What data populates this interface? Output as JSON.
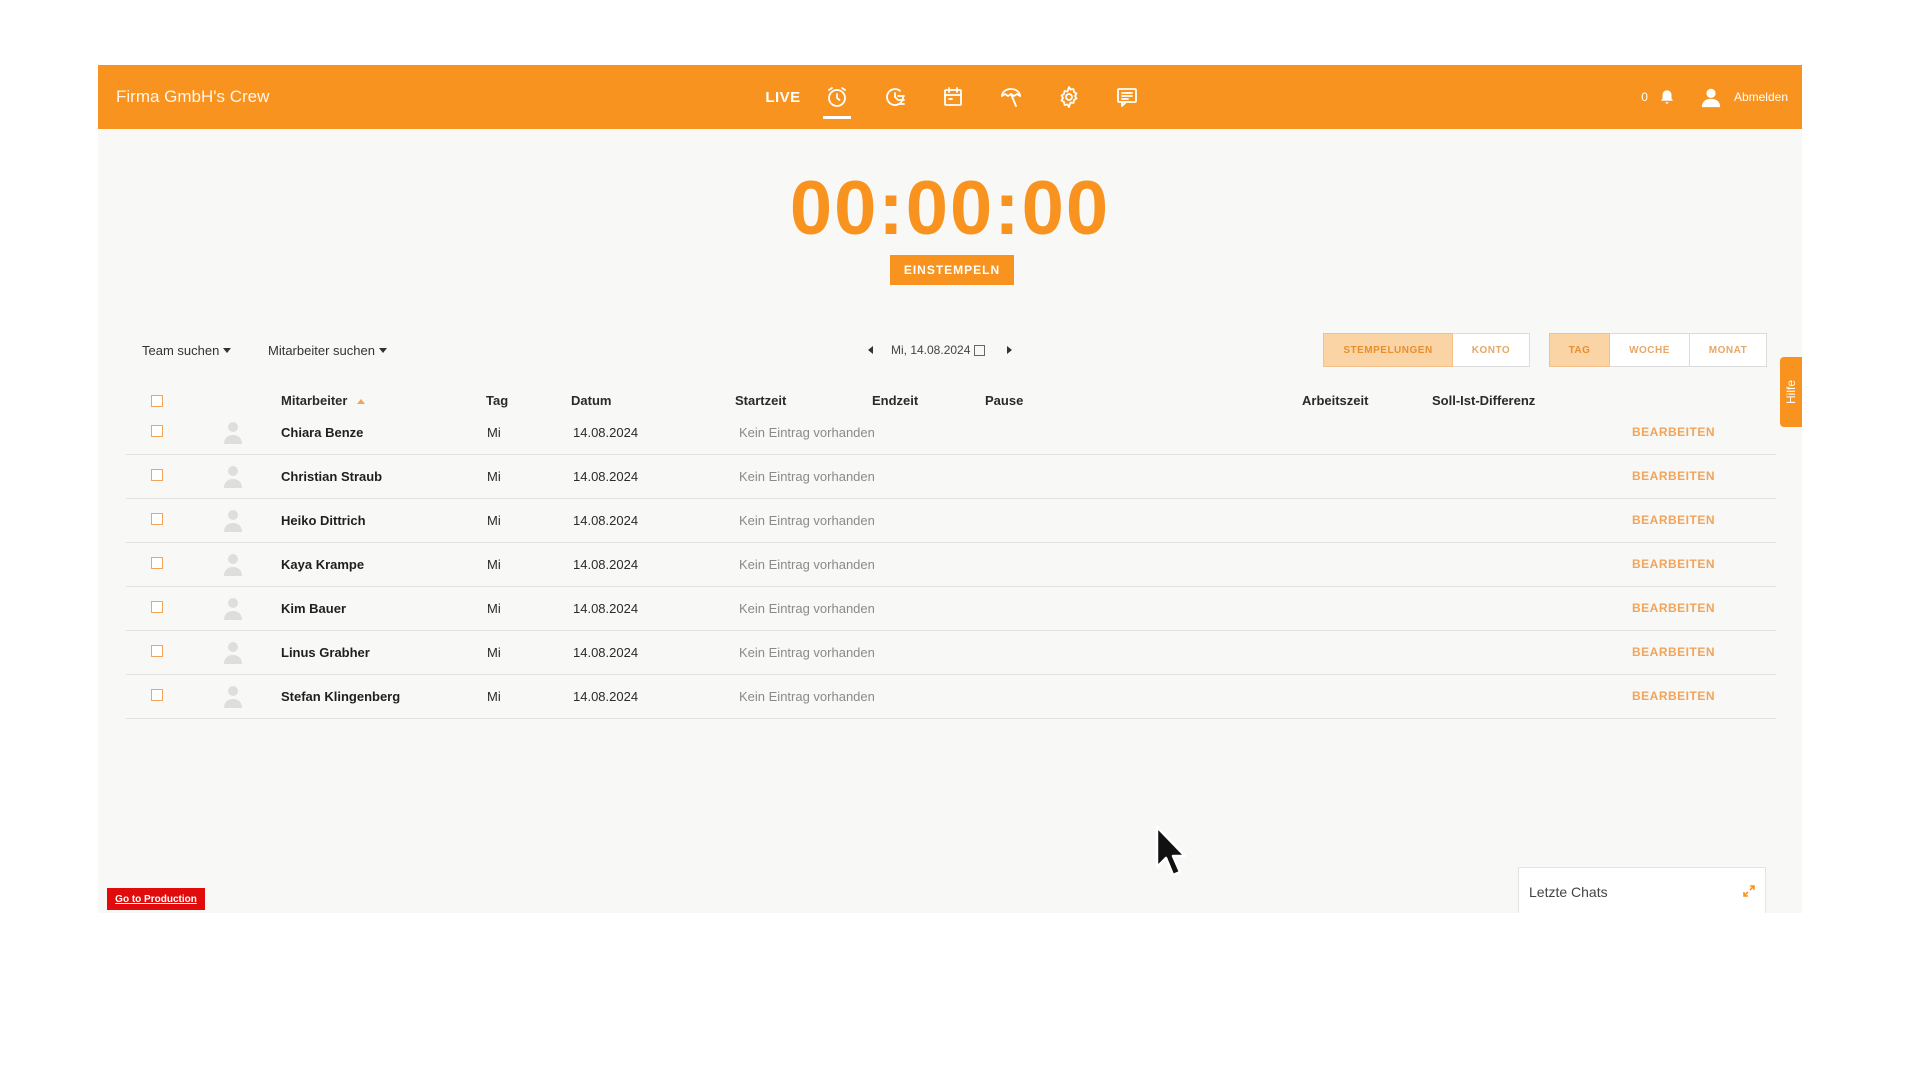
{
  "header": {
    "brand": "Firma GmbH's Crew",
    "live_label": "LIVE",
    "notification_count": "0",
    "logout_label": "Abmelden"
  },
  "timer": {
    "value": "00:00:00",
    "button_label": "EINSTEMPELN"
  },
  "filters": {
    "team_label": "Team suchen",
    "employee_label": "Mitarbeiter suchen",
    "date": "Mi, 14.08.2024"
  },
  "view_toggle": {
    "stamps": "STEMPELUNGEN",
    "account": "KONTO"
  },
  "period_toggle": {
    "day": "TAG",
    "week": "WOCHE",
    "month": "MONAT"
  },
  "help_label": "Hilfe",
  "table": {
    "headers": {
      "employee": "Mitarbeiter",
      "day": "Tag",
      "date": "Datum",
      "start": "Startzeit",
      "end": "Endzeit",
      "pause": "Pause",
      "worktime": "Arbeitszeit",
      "diff": "Soll-Ist-Differenz"
    },
    "rows": [
      {
        "name": "Chiara Benze",
        "day": "Mi",
        "date": "14.08.2024",
        "status": "Kein Eintrag vorhanden",
        "action": "BEARBEITEN"
      },
      {
        "name": "Christian Straub",
        "day": "Mi",
        "date": "14.08.2024",
        "status": "Kein Eintrag vorhanden",
        "action": "BEARBEITEN"
      },
      {
        "name": "Heiko Dittrich",
        "day": "Mi",
        "date": "14.08.2024",
        "status": "Kein Eintrag vorhanden",
        "action": "BEARBEITEN"
      },
      {
        "name": "Kaya Krampe",
        "day": "Mi",
        "date": "14.08.2024",
        "status": "Kein Eintrag vorhanden",
        "action": "BEARBEITEN"
      },
      {
        "name": "Kim Bauer",
        "day": "Mi",
        "date": "14.08.2024",
        "status": "Kein Eintrag vorhanden",
        "action": "BEARBEITEN"
      },
      {
        "name": "Linus Grabher",
        "day": "Mi",
        "date": "14.08.2024",
        "status": "Kein Eintrag vorhanden",
        "action": "BEARBEITEN"
      },
      {
        "name": "Stefan Klingenberg",
        "day": "Mi",
        "date": "14.08.2024",
        "status": "Kein Eintrag vorhanden",
        "action": "BEARBEITEN"
      }
    ]
  },
  "production_button": "Go to Production",
  "chats": {
    "title": "Letzte Chats"
  },
  "colors": {
    "accent": "#f9931f",
    "accent_light": "#fbd4a5",
    "danger": "#e20b0b"
  }
}
